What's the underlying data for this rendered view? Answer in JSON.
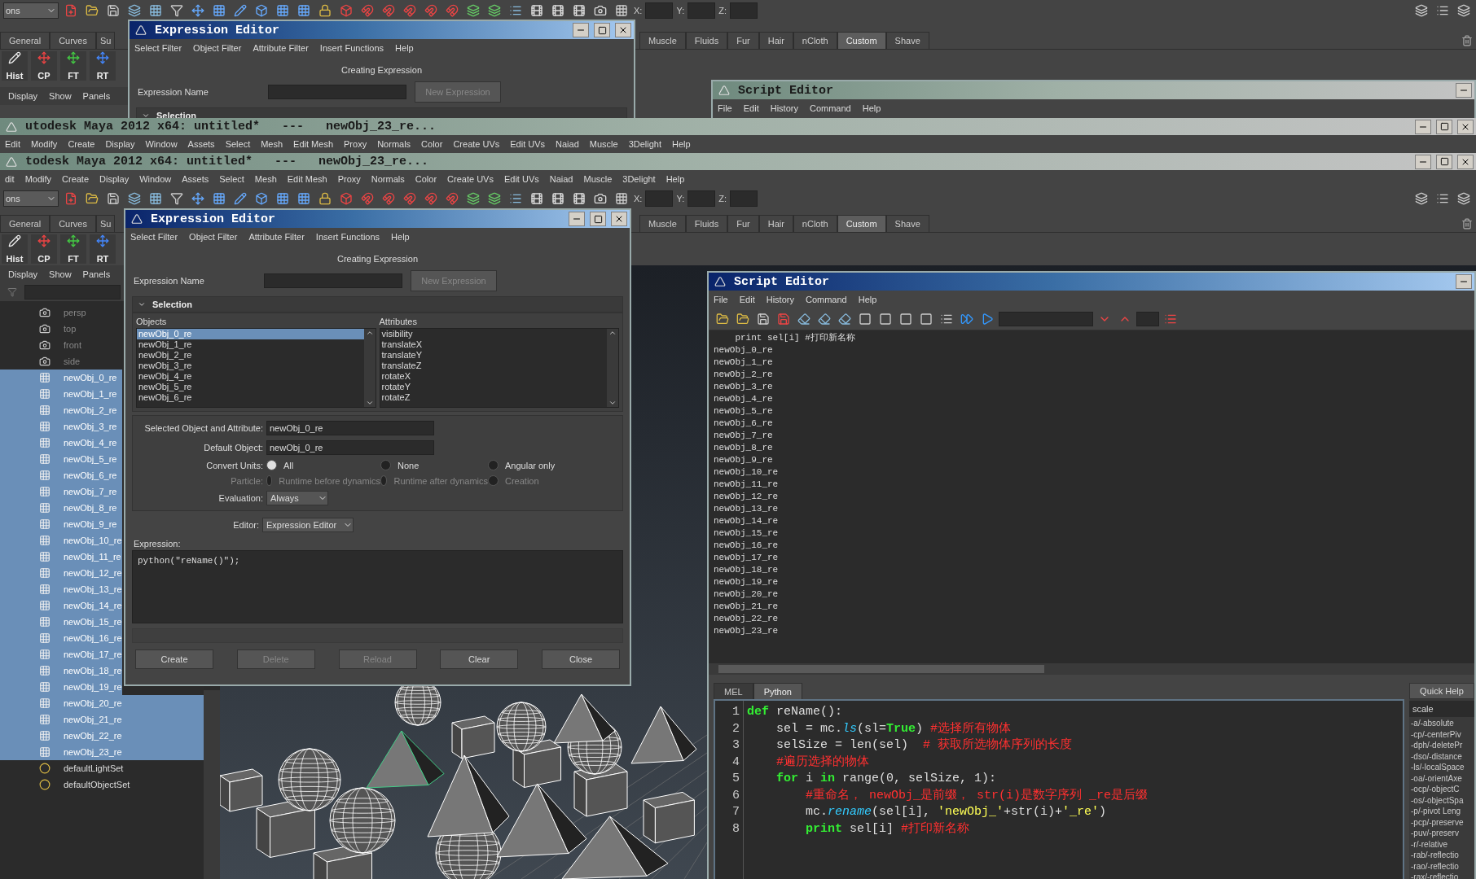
{
  "top_layer": {
    "toolbar": {
      "mode_menu": "ons",
      "coords": [
        "X:",
        "Y:",
        "Z:"
      ]
    },
    "shelf_tabs_left": [
      {
        "label": "General",
        "selected": false
      },
      {
        "label": "Curves",
        "selected": false
      },
      {
        "label": "Su",
        "selected": false
      }
    ],
    "shelf_tabs_right": [
      {
        "label": "Muscle",
        "selected": false
      },
      {
        "label": "Fluids",
        "selected": false
      },
      {
        "label": "Fur",
        "selected": false
      },
      {
        "label": "Hair",
        "selected": false
      },
      {
        "label": "nCloth",
        "selected": false
      },
      {
        "label": "Custom",
        "selected": true
      },
      {
        "label": "Shave",
        "selected": false
      }
    ],
    "shelf_buttons": [
      "Hist",
      "CP",
      "FT",
      "RT"
    ],
    "panel_menu": [
      "Display",
      "Show",
      "Panels"
    ],
    "expression_editor": {
      "title": "Expression Editor",
      "active": true,
      "menu": [
        "Select Filter",
        "Object Filter",
        "Attribute Filter",
        "Insert Functions",
        "Help"
      ],
      "heading": "Creating Expression",
      "name_label": "Expression Name",
      "new_button": "New Expression",
      "section": "Selection"
    },
    "script_editor": {
      "title": "Script Editor",
      "active": false,
      "menu": [
        "File",
        "Edit",
        "History",
        "Command",
        "Help"
      ]
    }
  },
  "title_bars": [
    {
      "title": "utodesk Maya 2012 x64: untitled*   ---   newObj_23_re...",
      "active": false,
      "menu": [
        "Edit",
        "Modify",
        "Create",
        "Display",
        "Window",
        "Assets",
        "Select",
        "Mesh",
        "Edit Mesh",
        "Proxy",
        "Normals",
        "Color",
        "Create UVs",
        "Edit UVs",
        "Naiad",
        "Muscle",
        "3Delight",
        "Help"
      ]
    },
    {
      "title": "todesk Maya 2012 x64: untitled*   ---   newObj_23_re...",
      "active": false,
      "menu": [
        "dit",
        "Modify",
        "Create",
        "Display",
        "Window",
        "Assets",
        "Select",
        "Mesh",
        "Edit Mesh",
        "Proxy",
        "Normals",
        "Color",
        "Create UVs",
        "Edit UVs",
        "Naiad",
        "Muscle",
        "3Delight",
        "Help"
      ]
    }
  ],
  "toolbar": {
    "mode_menu": "ons",
    "coords": [
      "X:",
      "Y:",
      "Z:"
    ]
  },
  "shelf_tabs_left": [
    {
      "label": "General",
      "selected": false
    },
    {
      "label": "Curves",
      "selected": false
    },
    {
      "label": "Su",
      "selected": false
    }
  ],
  "shelf_tabs_right": [
    {
      "label": "Muscle",
      "selected": false
    },
    {
      "label": "Fluids",
      "selected": false
    },
    {
      "label": "Fur",
      "selected": false
    },
    {
      "label": "Hair",
      "selected": false
    },
    {
      "label": "nCloth",
      "selected": false
    },
    {
      "label": "Custom",
      "selected": true
    },
    {
      "label": "Shave",
      "selected": false
    }
  ],
  "shelf_buttons": [
    "Hist",
    "CP",
    "FT",
    "RT"
  ],
  "outliner": {
    "menu": [
      "Display",
      "Show",
      "Panels"
    ],
    "items": [
      {
        "label": "persp",
        "kind": "camera",
        "selected": false
      },
      {
        "label": "top",
        "kind": "camera",
        "selected": false
      },
      {
        "label": "front",
        "kind": "camera",
        "selected": false
      },
      {
        "label": "side",
        "kind": "camera",
        "selected": false
      },
      {
        "label": "newObj_0_re",
        "kind": "mesh",
        "selected": true
      },
      {
        "label": "newObj_1_re",
        "kind": "mesh",
        "selected": true
      },
      {
        "label": "newObj_2_re",
        "kind": "mesh",
        "selected": true
      },
      {
        "label": "newObj_3_re",
        "kind": "mesh",
        "selected": true
      },
      {
        "label": "newObj_4_re",
        "kind": "mesh",
        "selected": true
      },
      {
        "label": "newObj_5_re",
        "kind": "mesh",
        "selected": true
      },
      {
        "label": "newObj_6_re",
        "kind": "mesh",
        "selected": true
      },
      {
        "label": "newObj_7_re",
        "kind": "mesh",
        "selected": true
      },
      {
        "label": "newObj_8_re",
        "kind": "mesh",
        "selected": true
      },
      {
        "label": "newObj_9_re",
        "kind": "mesh",
        "selected": true
      },
      {
        "label": "newObj_10_re",
        "kind": "mesh",
        "selected": true
      },
      {
        "label": "newObj_11_re",
        "kind": "mesh",
        "selected": true
      },
      {
        "label": "newObj_12_re",
        "kind": "mesh",
        "selected": true
      },
      {
        "label": "newObj_13_re",
        "kind": "mesh",
        "selected": true
      },
      {
        "label": "newObj_14_re",
        "kind": "mesh",
        "selected": true
      },
      {
        "label": "newObj_15_re",
        "kind": "mesh",
        "selected": true
      },
      {
        "label": "newObj_16_re",
        "kind": "mesh",
        "selected": true
      },
      {
        "label": "newObj_17_re",
        "kind": "mesh",
        "selected": true
      },
      {
        "label": "newObj_18_re",
        "kind": "mesh",
        "selected": true
      },
      {
        "label": "newObj_19_re",
        "kind": "mesh",
        "selected": true
      },
      {
        "label": "newObj_20_re",
        "kind": "mesh",
        "selected": true
      },
      {
        "label": "newObj_21_re",
        "kind": "mesh",
        "selected": true
      },
      {
        "label": "newObj_22_re",
        "kind": "mesh",
        "selected": true
      },
      {
        "label": "newObj_23_re",
        "kind": "mesh",
        "selected": true
      },
      {
        "label": "defaultLightSet",
        "kind": "set",
        "selected": false
      },
      {
        "label": "defaultObjectSet",
        "kind": "set",
        "selected": false
      }
    ]
  },
  "expression_editor": {
    "title": "Expression Editor",
    "active": true,
    "menu": [
      "Select Filter",
      "Object Filter",
      "Attribute Filter",
      "Insert Functions",
      "Help"
    ],
    "heading": "Creating Expression",
    "name_label": "Expression Name",
    "new_button": "New Expression",
    "section": "Selection",
    "objects_label": "Objects",
    "objects": [
      {
        "label": "newObj_0_re",
        "selected": true
      },
      {
        "label": "newObj_1_re",
        "selected": false
      },
      {
        "label": "newObj_2_re",
        "selected": false
      },
      {
        "label": "newObj_3_re",
        "selected": false
      },
      {
        "label": "newObj_4_re",
        "selected": false
      },
      {
        "label": "newObj_5_re",
        "selected": false
      },
      {
        "label": "newObj_6_re",
        "selected": false
      }
    ],
    "attributes_label": "Attributes",
    "attributes": [
      {
        "label": "visibility",
        "selected": false
      },
      {
        "label": "translateX",
        "selected": false
      },
      {
        "label": "translateY",
        "selected": false
      },
      {
        "label": "translateZ",
        "selected": false
      },
      {
        "label": "rotateX",
        "selected": false
      },
      {
        "label": "rotateY",
        "selected": false
      },
      {
        "label": "rotateZ",
        "selected": false
      }
    ],
    "fields": [
      {
        "label": "Selected Object and Attribute:",
        "value": "newObj_0_re"
      },
      {
        "label": "Default Object:",
        "value": "newObj_0_re"
      }
    ],
    "radio_rows": [
      {
        "label": "Convert Units:",
        "disabled": false,
        "options": [
          {
            "label": "All",
            "selected": true
          },
          {
            "label": "None",
            "selected": false
          },
          {
            "label": "Angular only",
            "selected": false
          }
        ]
      },
      {
        "label": "Particle:",
        "disabled": true,
        "options": [
          {
            "label": "Runtime before dynamics",
            "selected": false
          },
          {
            "label": "Runtime after dynamics",
            "selected": false
          },
          {
            "label": "Creation",
            "selected": false
          }
        ]
      }
    ],
    "evaluation": {
      "label": "Evaluation:",
      "value": "Always"
    },
    "editor": {
      "label": "Editor:",
      "value": "Expression Editor"
    },
    "expression_label": "Expression:",
    "expression": "python(\"reName()\");",
    "buttons": [
      {
        "label": "Create",
        "disabled": false
      },
      {
        "label": "Delete",
        "disabled": true
      },
      {
        "label": "Reload",
        "disabled": true
      },
      {
        "label": "Clear",
        "disabled": false
      },
      {
        "label": "Close",
        "disabled": false
      }
    ]
  },
  "script_editor": {
    "title": "Script Editor",
    "active": true,
    "menu": [
      "File",
      "Edit",
      "History",
      "Command",
      "Help"
    ],
    "output": [
      "    print sel[i] #打印新名称",
      "newObj_0_re",
      "newObj_1_re",
      "newObj_2_re",
      "newObj_3_re",
      "newObj_4_re",
      "newObj_5_re",
      "newObj_6_re",
      "newObj_7_re",
      "newObj_8_re",
      "newObj_9_re",
      "newObj_10_re",
      "newObj_11_re",
      "newObj_12_re",
      "newObj_13_re",
      "newObj_14_re",
      "newObj_15_re",
      "newObj_16_re",
      "newObj_17_re",
      "newObj_18_re",
      "newObj_19_re",
      "newObj_20_re",
      "newObj_21_re",
      "newObj_22_re",
      "newObj_23_re"
    ],
    "tabs": [
      {
        "label": "MEL",
        "selected": false
      },
      {
        "label": "Python",
        "selected": true
      }
    ],
    "code": [
      {
        "number": "1",
        "segments": [
          {
            "kind": "keyword",
            "text": "def"
          },
          {
            "kind": "plain",
            "text": " reName():"
          }
        ]
      },
      {
        "number": "2",
        "segments": [
          {
            "kind": "plain",
            "text": "    sel = mc."
          },
          {
            "kind": "call",
            "text": "ls"
          },
          {
            "kind": "plain",
            "text": "(sl="
          },
          {
            "kind": "keyword",
            "text": "True"
          },
          {
            "kind": "plain",
            "text": ") "
          },
          {
            "kind": "comment",
            "text": "#选择所有物体"
          }
        ]
      },
      {
        "number": "3",
        "segments": [
          {
            "kind": "plain",
            "text": "    selSize = len(sel)  "
          },
          {
            "kind": "comment",
            "text": "# 获取所选物体序列的长度"
          }
        ]
      },
      {
        "number": "4",
        "segments": [
          {
            "kind": "comment",
            "text": "    #遍历选择的物体"
          }
        ]
      },
      {
        "number": "5",
        "segments": [
          {
            "kind": "keyword",
            "text": "    for"
          },
          {
            "kind": "plain",
            "text": " i "
          },
          {
            "kind": "keyword",
            "text": "in"
          },
          {
            "kind": "plain",
            "text": " range(0, selSize, 1):"
          }
        ]
      },
      {
        "number": "6",
        "segments": [
          {
            "kind": "comment",
            "text": "        #重命名， newObj_是前缀， str(i)是数字序列 _re是后缀"
          }
        ]
      },
      {
        "number": "7",
        "segments": [
          {
            "kind": "plain",
            "text": "        mc."
          },
          {
            "kind": "call",
            "text": "rename"
          },
          {
            "kind": "plain",
            "text": "(sel[i], "
          },
          {
            "kind": "string",
            "text": "'newObj_'"
          },
          {
            "kind": "plain",
            "text": "+str(i)+"
          },
          {
            "kind": "string",
            "text": "'_re'"
          },
          {
            "kind": "plain",
            "text": ")"
          }
        ]
      },
      {
        "number": "8",
        "segments": [
          {
            "kind": "keyword",
            "text": "        print"
          },
          {
            "kind": "plain",
            "text": " sel[i] "
          },
          {
            "kind": "comment",
            "text": "#打印新名称"
          }
        ]
      }
    ],
    "quick_help": {
      "button": "Quick Help",
      "query": "scale",
      "flags": [
        "-a/-absolute",
        "-cp/-centerPiv",
        "-dph/-deletePr",
        "-dso/-distance",
        "-ls/-localSpace",
        "-oa/-orientAxe",
        "-ocp/-objectC",
        "-os/-objectSpa",
        "-p/-pivot Leng",
        "-pcp/-preserve",
        "-puv/-preserv",
        "-r/-relative",
        "-rab/-reflectio",
        "-rao/-reflectio",
        "-rax/-reflectio"
      ]
    }
  }
}
